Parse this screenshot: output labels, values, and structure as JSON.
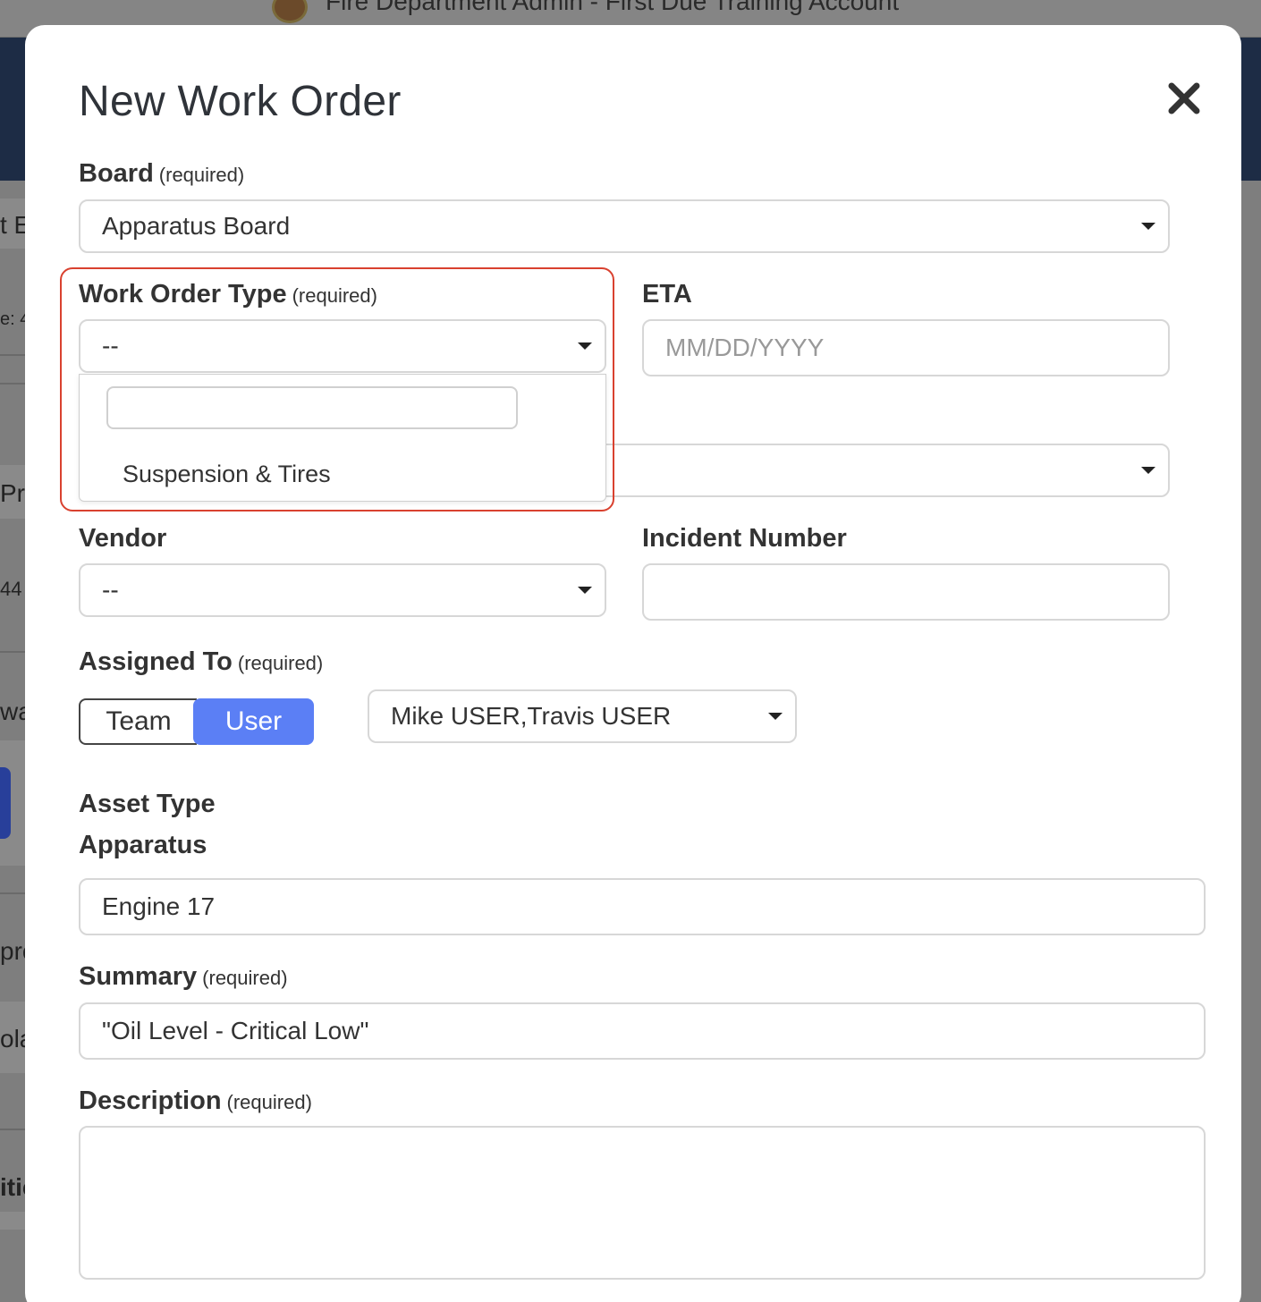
{
  "background": {
    "app_title": "Fire Department Admin - First Due Training Account",
    "fragments": [
      "t E",
      "e: 4",
      "Pr",
      "44",
      "wa",
      "pro",
      "ola",
      "itic"
    ]
  },
  "modal": {
    "title": "New Work Order",
    "close_icon": "close-icon"
  },
  "required_text": "(required)",
  "board": {
    "label": "Board",
    "value": "Apparatus Board"
  },
  "work_order_type": {
    "label": "Work Order Type",
    "value": "--",
    "search_value": "",
    "options": [
      "Suspension & Tires"
    ]
  },
  "eta": {
    "label": "ETA",
    "placeholder": "MM/DD/YYYY"
  },
  "vendor": {
    "label": "Vendor",
    "value": "--"
  },
  "incident_number": {
    "label": "Incident Number",
    "value": ""
  },
  "assigned_to": {
    "label": "Assigned To",
    "toggle": [
      "Team",
      "User"
    ],
    "selected_toggle": "User",
    "users_value": "Mike USER,Travis USER"
  },
  "asset": {
    "type_label": "Asset Type",
    "type_value": "Apparatus",
    "value": "Engine 17"
  },
  "summary": {
    "label": "Summary",
    "value": "\"Oil Level - Critical Low\""
  },
  "description": {
    "label": "Description",
    "value": ""
  },
  "colors": {
    "accent": "#5b7ff5",
    "highlight": "#d9412f",
    "navy": "#1d2c45"
  }
}
